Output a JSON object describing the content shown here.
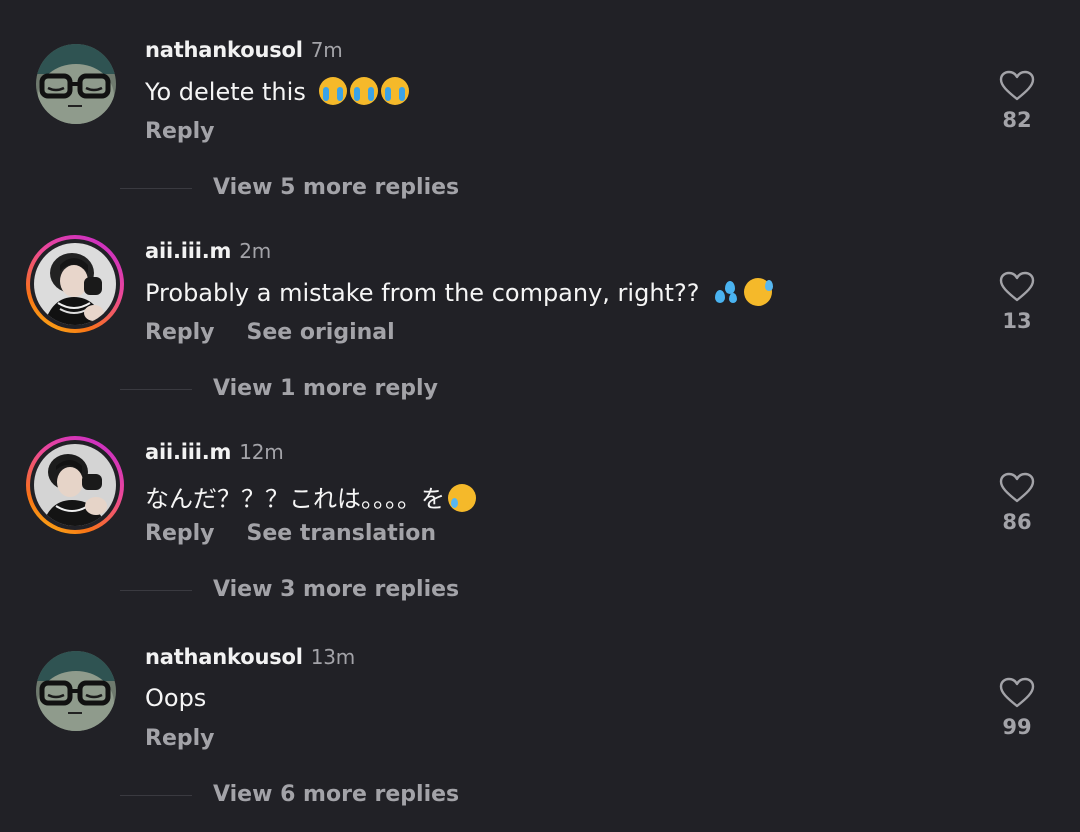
{
  "comments": [
    {
      "username": "nathankousol",
      "time": "7m",
      "text": "Yo delete this",
      "emojis": [
        "loudly-crying-face",
        "loudly-crying-face",
        "loudly-crying-face"
      ],
      "reply_label": "Reply",
      "secondary_action": "",
      "view_replies": "View 5 more replies",
      "likes": "82",
      "avatar": "sleeping-face-with-glasses"
    },
    {
      "username": "aii.iii.m",
      "time": "2m",
      "text": "Probably a mistake from the company, right??",
      "emojis": [
        "sweat-droplets",
        "grinning-face-with-sweat"
      ],
      "reply_label": "Reply",
      "secondary_action": "See original",
      "view_replies": "View 1 more reply",
      "likes": "13",
      "avatar": "profile-photo-with-story-ring"
    },
    {
      "username": "aii.iii.m",
      "time": "12m",
      "text": "なんだ？？？これは。。。。を",
      "emojis": [
        "face-holding-back-tears"
      ],
      "reply_label": "Reply",
      "secondary_action": "See translation",
      "view_replies": "View 3 more replies",
      "likes": "86",
      "avatar": "profile-photo-with-story-ring"
    },
    {
      "username": "nathankousol",
      "time": "13m",
      "text": "Oops",
      "emojis": [],
      "reply_label": "Reply",
      "secondary_action": "",
      "view_replies": "View 6 more replies",
      "likes": "99",
      "avatar": "sleeping-face-with-glasses"
    }
  ],
  "colors": {
    "background": "#212126",
    "text_primary": "#f5f5f5",
    "text_secondary": "#a3a3a8",
    "story_ring_start": "#c026d3",
    "story_ring_end": "#facc15"
  }
}
